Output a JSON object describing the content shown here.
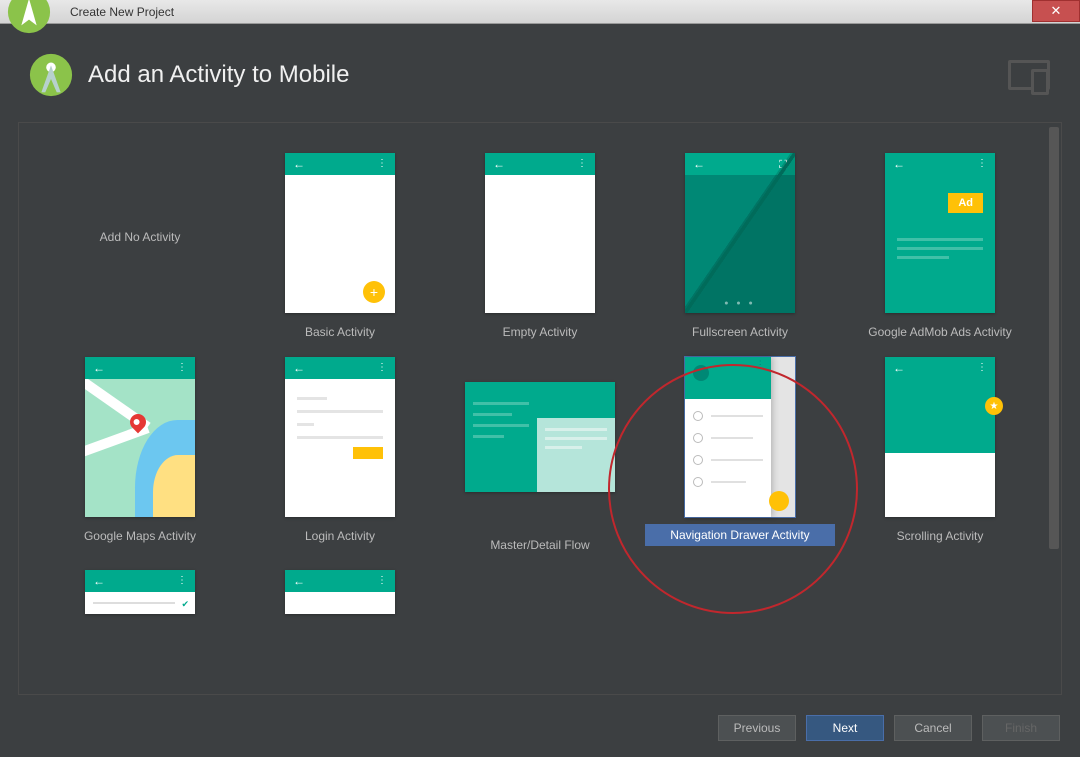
{
  "window": {
    "title": "Create New Project"
  },
  "header": {
    "title": "Add an Activity to Mobile"
  },
  "activities": [
    {
      "label": "Add No Activity",
      "kind": "none"
    },
    {
      "label": "Basic Activity",
      "kind": "basic"
    },
    {
      "label": "Empty Activity",
      "kind": "empty"
    },
    {
      "label": "Fullscreen Activity",
      "kind": "fullscreen"
    },
    {
      "label": "Google AdMob Ads Activity",
      "kind": "admob"
    },
    {
      "label": "Google Maps Activity",
      "kind": "maps"
    },
    {
      "label": "Login Activity",
      "kind": "login"
    },
    {
      "label": "Master/Detail Flow",
      "kind": "masterdetail"
    },
    {
      "label": "Navigation Drawer Activity",
      "kind": "navdrawer",
      "selected": true
    },
    {
      "label": "Scrolling Activity",
      "kind": "scrolling"
    },
    {
      "label": "",
      "kind": "partial-checked"
    },
    {
      "label": "",
      "kind": "partial"
    }
  ],
  "buttons": {
    "previous": "Previous",
    "next": "Next",
    "cancel": "Cancel",
    "finish": "Finish"
  },
  "ad_badge": "Ad"
}
